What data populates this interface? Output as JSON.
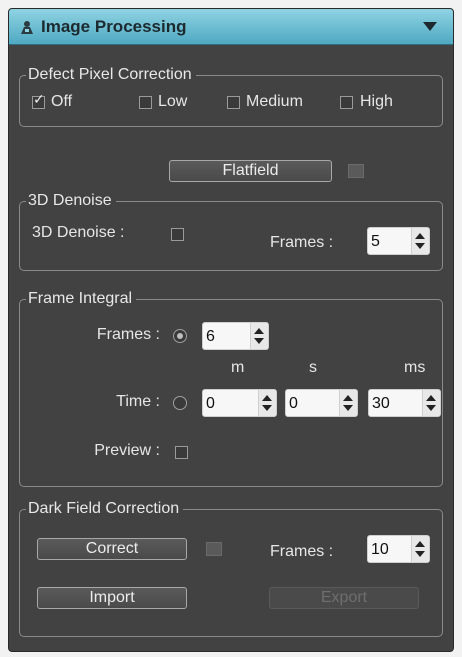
{
  "header": {
    "title": "Image Processing",
    "logo_icon": "app-logo-icon",
    "collapse_icon": "triangle-down-icon",
    "accent": "#5fb9cf"
  },
  "defect_pixel": {
    "legend": "Defect Pixel Correction",
    "options": [
      {
        "label": "Off",
        "checked": true
      },
      {
        "label": "Low",
        "checked": false
      },
      {
        "label": "Medium",
        "checked": false
      },
      {
        "label": "High",
        "checked": false
      }
    ]
  },
  "flatfield": {
    "button_label": "Flatfield"
  },
  "denoise": {
    "legend": "3D Denoise",
    "label": "3D Denoise :",
    "frames_label": "Frames :",
    "frames_value": "5"
  },
  "frame_integral": {
    "legend": "Frame Integral",
    "frames_label": "Frames :",
    "frames_value": "6",
    "time_label": "Time :",
    "unit_m": "m",
    "unit_s": "s",
    "unit_ms": "ms",
    "time_m": "0",
    "time_s": "0",
    "time_ms": "30",
    "preview_label": "Preview :"
  },
  "dark_field": {
    "legend": "Dark Field Correction",
    "correct_label": "Correct",
    "frames_label": "Frames :",
    "frames_value": "10",
    "import_label": "Import",
    "export_label": "Export"
  }
}
